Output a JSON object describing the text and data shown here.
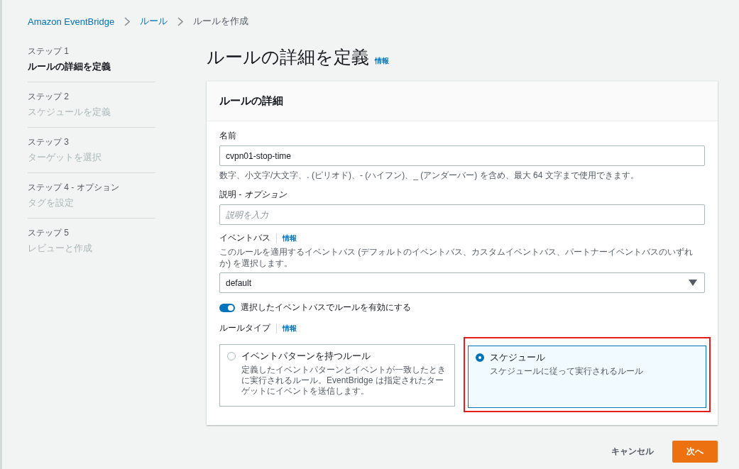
{
  "breadcrumb": [
    {
      "label": "Amazon EventBridge",
      "link": true
    },
    {
      "label": "ルール",
      "link": true
    },
    {
      "label": "ルールを作成",
      "link": false
    }
  ],
  "steps": [
    {
      "label": "ステップ 1",
      "title": "ルールの詳細を定義",
      "selected": true
    },
    {
      "label": "ステップ 2",
      "title": "スケジュールを定義",
      "selected": false
    },
    {
      "label": "ステップ 3",
      "title": "ターゲットを選択",
      "selected": false
    },
    {
      "label": "ステップ 4 - オプション",
      "title": "タグを設定",
      "selected": false
    },
    {
      "label": "ステップ 5",
      "title": "レビューと作成",
      "selected": false
    }
  ],
  "page_title": "ルールの詳細を定義",
  "page_info": "情報",
  "card": {
    "title": "ルールの詳細",
    "name_field": {
      "label": "名前",
      "value": "cvpn01-stop-time",
      "hint": "数字、小文字/大文字、. (ピリオド)、- (ハイフン)、_ (アンダーバー) を含め、最大 64 文字まで使用できます。"
    },
    "description_field": {
      "label": "説明 - *オプション*",
      "placeholder": "説明を入力"
    },
    "event_bus": {
      "label": "イベントバス",
      "info": "情報",
      "description": "このルールを適用するイベントバス (デフォルトのイベントバス、カスタムイベントバス、パートナーイベントバスのいずれか) を選択します。",
      "value": "default"
    },
    "enable_toggle": {
      "label": "選択したイベントバスでルールを有効にする",
      "on": true
    },
    "rule_type": {
      "label": "ルールタイプ",
      "info": "情報",
      "options": [
        {
          "title": "イベントパターンを持つルール",
          "description": "定義したイベントパターンとイベントが一致したときに実行されるルール。EventBridge は指定されたターゲットにイベントを送信します。",
          "selected": false,
          "highlighted": false
        },
        {
          "title": "スケジュール",
          "description": "スケジュールに従って実行されるルール",
          "selected": true,
          "highlighted": true
        }
      ]
    }
  },
  "buttons": {
    "cancel": "キャンセル",
    "next": "次へ"
  }
}
